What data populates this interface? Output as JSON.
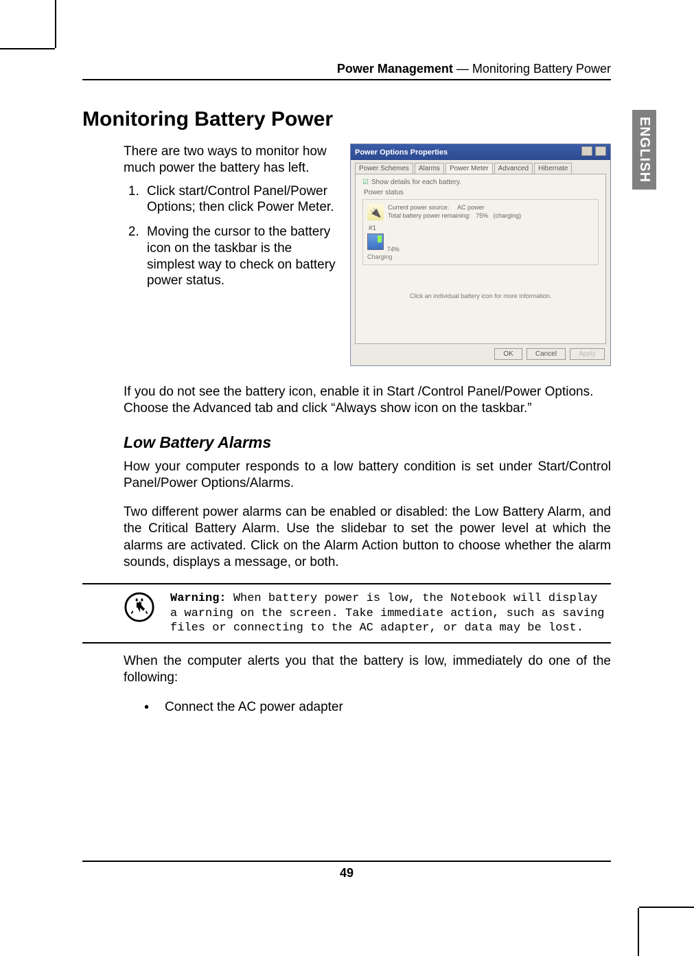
{
  "side_tab": "ENGLISH",
  "running_head": {
    "bold": "Power Management",
    "rest": " — Monitoring Battery Power"
  },
  "h1": "Monitoring Battery Power",
  "intro_paragraph": "There are two ways to monitor how much power the battery has left.",
  "steps": [
    "Click start/Control Panel/Power Options; then click Power Meter.",
    "Moving the cursor to the battery icon on the taskbar is the simplest way to check on battery power status."
  ],
  "dialog": {
    "title": "Power Options Properties",
    "tabs": [
      "Power Schemes",
      "Alarms",
      "Power Meter",
      "Advanced",
      "Hibernate"
    ],
    "active_tab_index": 2,
    "show_details_label": "Show details for each battery.",
    "group_label": "Power status",
    "current_source_label": "Current power source:",
    "current_source_value": "AC power",
    "remaining_label": "Total battery power remaining:",
    "remaining_value": "75%",
    "remaining_state": "(charging)",
    "battery_num": "#1",
    "battery_pct": "74%",
    "battery_state": "Charging",
    "hint": "Click an individual battery icon for more information.",
    "buttons": {
      "ok": "OK",
      "cancel": "Cancel",
      "apply": "Apply"
    }
  },
  "after_dialog": "If you do not see the battery icon, enable it in Start /Control Panel/Power Options. Choose the Advanced tab and click “Always show icon on the taskbar.”",
  "h2": "Low Battery Alarms",
  "alarms_p1": "How your computer responds to a low battery condition is set under Start/Control Panel/Power Options/Alarms.",
  "alarms_p2": "Two different power alarms can be enabled or disabled: the Low Battery Alarm, and the Critical Battery Alarm. Use the slidebar to set the power level at which the alarms are activated. Click on the Alarm Action button to choose whether the alarm sounds, displays a message, or both.",
  "warning": {
    "label": "Warning:",
    "text": " When battery power is low, the Notebook will display a warning on the screen. Take immediate action, such as saving files or connecting to the AC adapter, or data may be lost."
  },
  "after_warning": "When the computer alerts you that the battery is low, immediately do one of the following:",
  "bullet_1": "Connect the AC power adapter",
  "page_number": "49"
}
